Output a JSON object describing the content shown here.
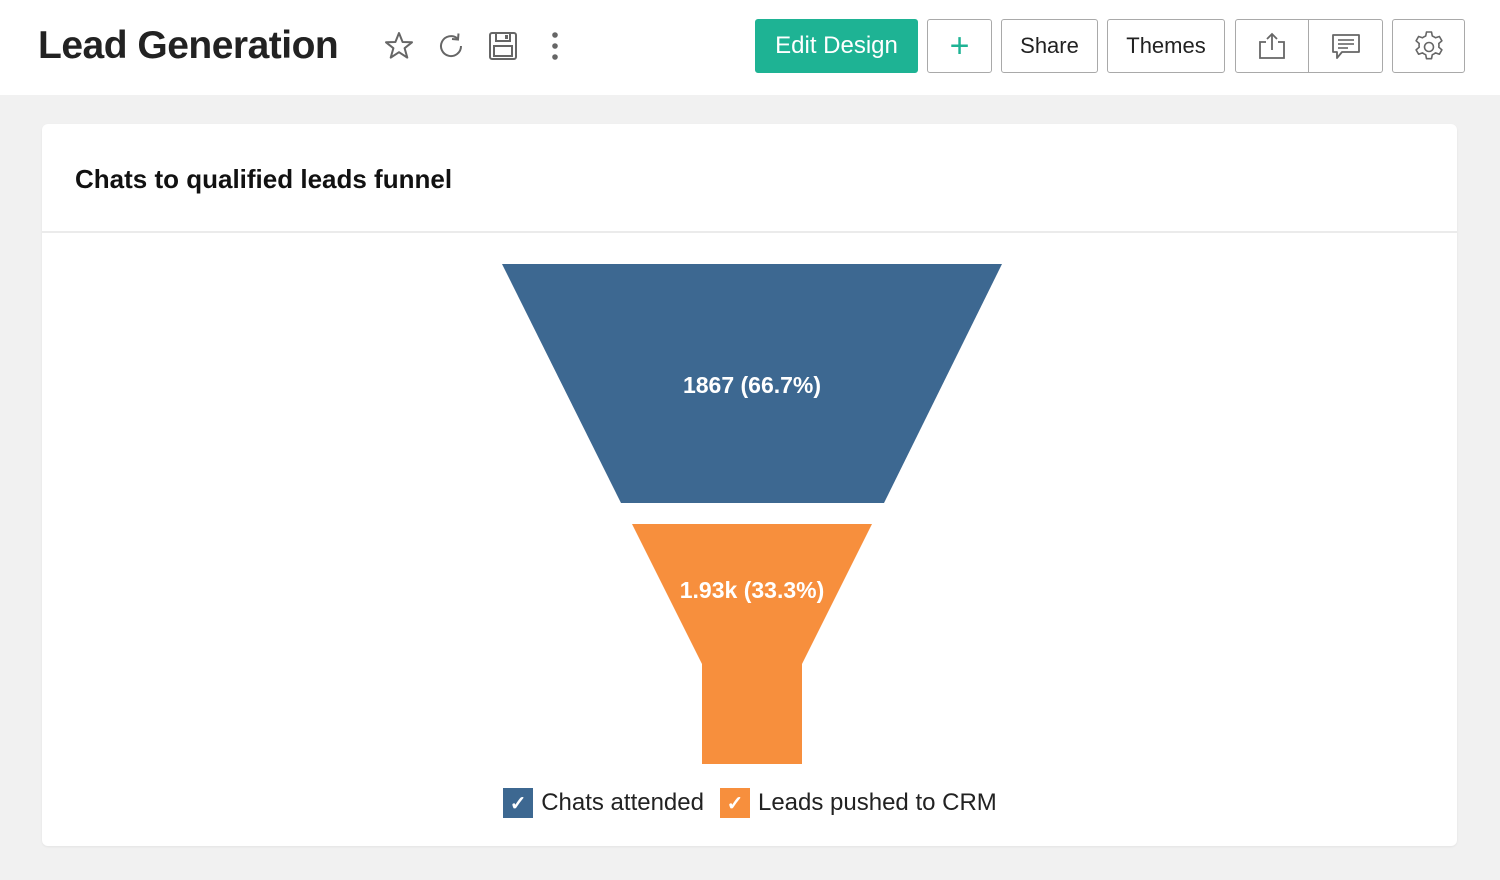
{
  "header": {
    "title": "Lead Generation",
    "icons": [
      "star-icon",
      "refresh-icon",
      "save-icon",
      "more-vertical-icon"
    ]
  },
  "toolbar": {
    "edit_design_label": "Edit Design",
    "add_label": "+",
    "share_label": "Share",
    "themes_label": "Themes",
    "export_icon": "export-icon",
    "comment_icon": "comment-icon",
    "settings_icon": "gear-icon",
    "accent_color": "#1eb394"
  },
  "panel": {
    "title": "Chats to qualified leads funnel"
  },
  "chart_data": {
    "type": "funnel",
    "title": "Chats to qualified leads funnel",
    "stages": [
      {
        "name": "Chats attended",
        "value": 1867,
        "percent": 66.7,
        "label": "1867 (66.7%)",
        "color": "#3d6891"
      },
      {
        "name": "Leads pushed to CRM",
        "value": 1930,
        "percent": 33.3,
        "label": "1.93k (33.3%)",
        "color": "#f78f3d"
      }
    ],
    "legend": [
      {
        "label": "Chats attended",
        "checked": true,
        "color": "#3d6891"
      },
      {
        "label": "Leads pushed to CRM",
        "checked": true,
        "color": "#f78f3d"
      }
    ],
    "legend_position": "bottom-center"
  }
}
